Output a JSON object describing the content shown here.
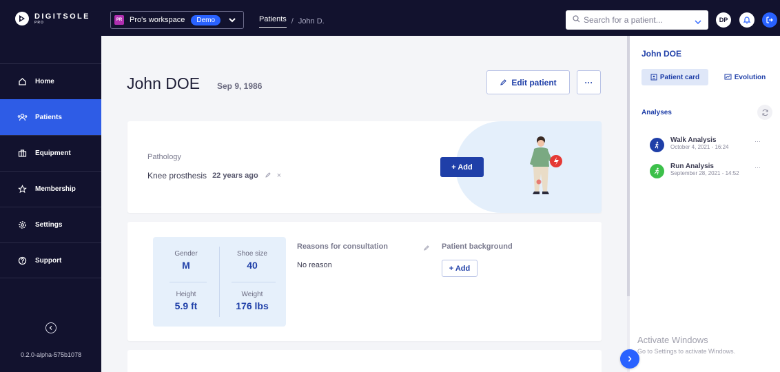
{
  "brand": {
    "name": "DIGITSOLE",
    "sub": "PRO",
    "logo_icon": "digitsole-logo-icon"
  },
  "workspace": {
    "badge": "PR",
    "name": "Pro's workspace",
    "tag": "Demo"
  },
  "breadcrumb": {
    "parent": "Patients",
    "separator": "/",
    "current": "John D."
  },
  "search": {
    "placeholder": "Search for a patient..."
  },
  "user": {
    "initials": "DP"
  },
  "sidebar": {
    "items": [
      {
        "label": "Home",
        "icon": "home-icon",
        "active": false
      },
      {
        "label": "Patients",
        "icon": "patients-icon",
        "active": true
      },
      {
        "label": "Equipment",
        "icon": "equipment-icon",
        "active": false
      },
      {
        "label": "Membership",
        "icon": "membership-icon",
        "active": false
      },
      {
        "label": "Settings",
        "icon": "gear-icon",
        "active": false
      },
      {
        "label": "Support",
        "icon": "help-icon",
        "active": false
      }
    ],
    "version": "0.2.0-alpha-575b1078"
  },
  "patient": {
    "name": "John DOE",
    "dob": "Sep 9, 1986",
    "edit_label": "Edit patient",
    "more_label": "···"
  },
  "pathology": {
    "label": "Pathology",
    "name": "Knee prosthesis",
    "ago": "22 years ago",
    "remove": "×",
    "add_label": "+ Add"
  },
  "stats": {
    "gender_label": "Gender",
    "gender": "M",
    "shoe_label": "Shoe size",
    "shoe": "40",
    "height_label": "Height",
    "height": "5.9 ft",
    "weight_label": "Weight",
    "weight": "176 lbs"
  },
  "consultation": {
    "label": "Reasons for consultation",
    "value": "No reason"
  },
  "background": {
    "label": "Patient background",
    "add_label": "+ Add"
  },
  "right_panel": {
    "name": "John DOE",
    "tabs": [
      {
        "label": "Patient card",
        "active": true
      },
      {
        "label": "Evolution",
        "active": false
      }
    ],
    "analyses_label": "Analyses",
    "analyses": [
      {
        "title": "Walk Analysis",
        "date": "October 4, 2021 - 16:24",
        "color": "#1f3fa8",
        "more": "···"
      },
      {
        "title": "Run Analysis",
        "date": "September 28, 2021 - 14:52",
        "color": "#3cc04a",
        "more": "···"
      }
    ]
  },
  "watermark": {
    "line1": "Activate Windows",
    "line2": "Go to Settings to activate Windows."
  },
  "colors": {
    "navy": "#12122e",
    "accent": "#2962ff",
    "primary": "#1f3fa8",
    "light_blue": "#e6f0fb"
  }
}
